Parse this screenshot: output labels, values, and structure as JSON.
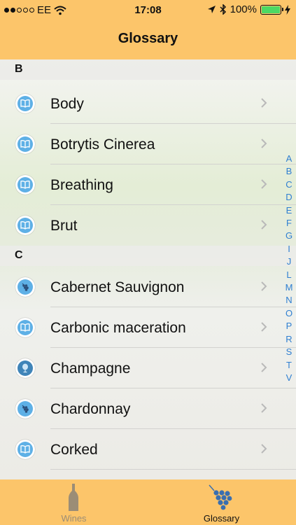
{
  "status_bar": {
    "carrier": "EE",
    "time": "17:08",
    "battery": "100%",
    "signal_bars_filled": 2,
    "signal_bars_total": 5
  },
  "nav": {
    "title": "Glossary"
  },
  "sections": [
    {
      "letter": "B",
      "items": [
        {
          "label": "Body",
          "icon": "book-icon"
        },
        {
          "label": "Botrytis Cinerea",
          "icon": "book-icon"
        },
        {
          "label": "Breathing",
          "icon": "book-icon"
        },
        {
          "label": "Brut",
          "icon": "book-icon"
        }
      ]
    },
    {
      "letter": "C",
      "items": [
        {
          "label": "Cabernet Sauvignon",
          "icon": "grapes-icon"
        },
        {
          "label": "Carbonic maceration",
          "icon": "book-icon"
        },
        {
          "label": "Champagne",
          "icon": "wine-glass-icon"
        },
        {
          "label": "Chardonnay",
          "icon": "grapes-icon"
        },
        {
          "label": "Corked",
          "icon": "book-icon"
        }
      ]
    }
  ],
  "index_letters": [
    "A",
    "B",
    "C",
    "D",
    "E",
    "F",
    "G",
    "I",
    "J",
    "L",
    "M",
    "N",
    "O",
    "P",
    "R",
    "S",
    "T",
    "V"
  ],
  "tabs": [
    {
      "label": "Wines",
      "icon": "wine-bottle-icon",
      "selected": false
    },
    {
      "label": "Glossary",
      "icon": "grapes-icon",
      "selected": true
    }
  ],
  "colors": {
    "bar": "#fcc56a",
    "index_letters": "#2f7fd1",
    "icon_blue": "#5eb0e6",
    "tab_selected": "#3a6fb0",
    "tab_unselected": "#9b8d76"
  }
}
